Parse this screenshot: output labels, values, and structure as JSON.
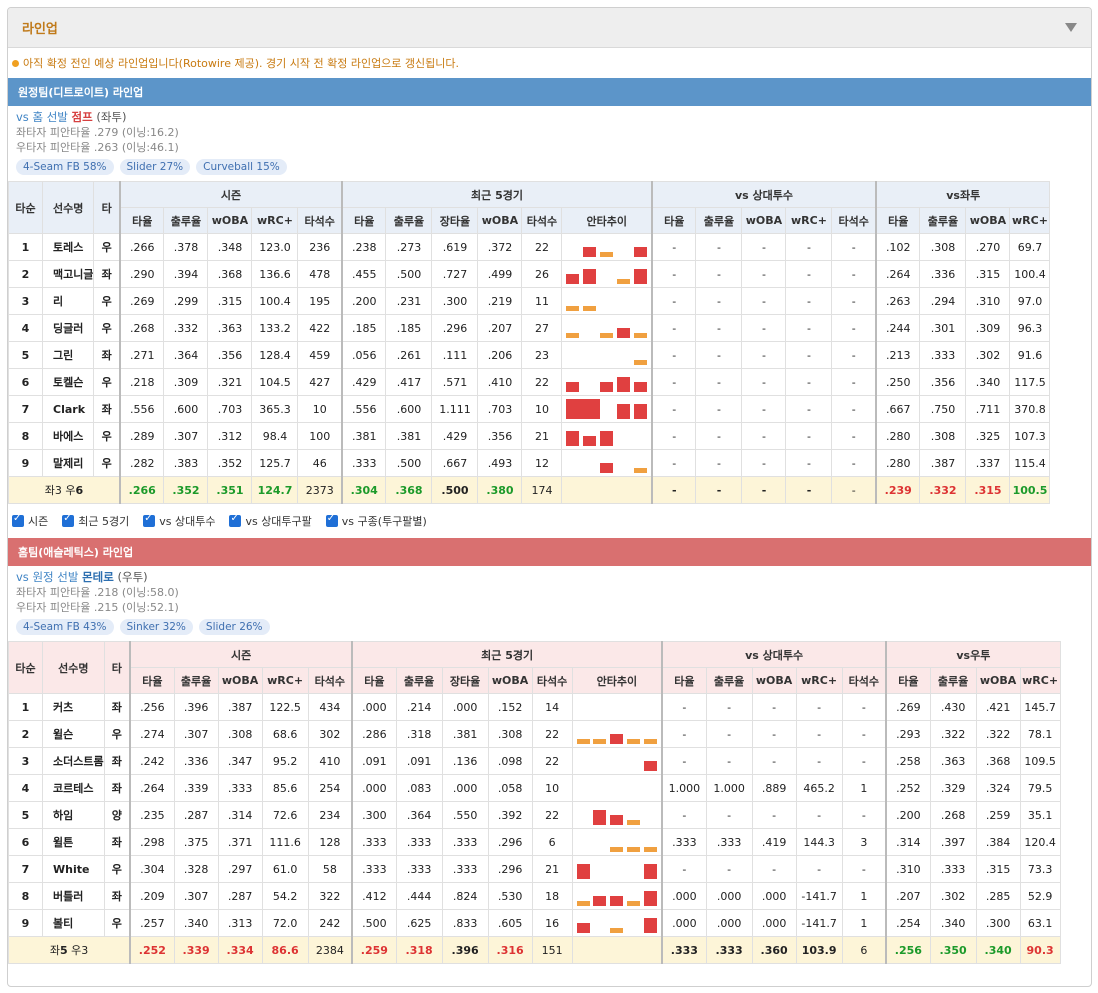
{
  "panel": {
    "title": "라인업",
    "notice": "아직 확정 전인 예상 라인업입니다(Rotowire 제공). 경기 시작 전 확정 라인업으로 갱신됩니다."
  },
  "away": {
    "bar": "원정팀(디트로이트) 라인업",
    "vs_text": "vs 홈 선발",
    "pitcher_name": "점프",
    "pitcher_hand": "(좌투)",
    "stat_lhb": "좌타자 피안타율 .279 (이닝:16.2)",
    "stat_rhb": "우타자 피안타율 .263 (이닝:46.1)",
    "pitches": [
      "4-Seam FB 58%",
      "Slider 27%",
      "Curveball 15%"
    ],
    "split_header": "vs좌투",
    "rows": [
      {
        "o": "1",
        "n": "토레스",
        "h": "우",
        "s": [
          ".266",
          ".378",
          ".348",
          "123.0",
          "236"
        ],
        "r": [
          ".238",
          ".273",
          ".619",
          ".372",
          "22"
        ],
        "spark": [
          0,
          2,
          1,
          0,
          2
        ],
        "v": [
          "-",
          "-",
          "-",
          "-",
          "-"
        ],
        "sp": [
          ".102",
          ".308",
          ".270",
          "69.7"
        ]
      },
      {
        "o": "2",
        "n": "맥고니글",
        "h": "좌",
        "s": [
          ".290",
          ".394",
          ".368",
          "136.6",
          "478"
        ],
        "r": [
          ".455",
          ".500",
          ".727",
          ".499",
          "26"
        ],
        "spark": [
          2,
          3,
          0,
          1,
          3
        ],
        "v": [
          "-",
          "-",
          "-",
          "-",
          "-"
        ],
        "sp": [
          ".264",
          ".336",
          ".315",
          "100.4"
        ]
      },
      {
        "o": "3",
        "n": "리",
        "h": "우",
        "s": [
          ".269",
          ".299",
          ".315",
          "100.4",
          "195"
        ],
        "r": [
          ".200",
          ".231",
          ".300",
          ".219",
          "11"
        ],
        "spark": [
          1,
          1,
          0,
          0,
          0
        ],
        "v": [
          "-",
          "-",
          "-",
          "-",
          "-"
        ],
        "sp": [
          ".263",
          ".294",
          ".310",
          "97.0"
        ]
      },
      {
        "o": "4",
        "n": "딩글러",
        "h": "우",
        "s": [
          ".268",
          ".332",
          ".363",
          "133.2",
          "422"
        ],
        "r": [
          ".185",
          ".185",
          ".296",
          ".207",
          "27"
        ],
        "spark": [
          1,
          0,
          1,
          2,
          1
        ],
        "v": [
          "-",
          "-",
          "-",
          "-",
          "-"
        ],
        "sp": [
          ".244",
          ".301",
          ".309",
          "96.3"
        ]
      },
      {
        "o": "5",
        "n": "그린",
        "h": "좌",
        "s": [
          ".271",
          ".364",
          ".356",
          "128.4",
          "459"
        ],
        "r": [
          ".056",
          ".261",
          ".111",
          ".206",
          "23"
        ],
        "spark": [
          0,
          0,
          0,
          0,
          1
        ],
        "v": [
          "-",
          "-",
          "-",
          "-",
          "-"
        ],
        "sp": [
          ".213",
          ".333",
          ".302",
          "91.6"
        ]
      },
      {
        "o": "6",
        "n": "토켈슨",
        "h": "우",
        "s": [
          ".218",
          ".309",
          ".321",
          "104.5",
          "427"
        ],
        "r": [
          ".429",
          ".417",
          ".571",
          ".410",
          "22"
        ],
        "spark": [
          2,
          0,
          2,
          3,
          2
        ],
        "v": [
          "-",
          "-",
          "-",
          "-",
          "-"
        ],
        "sp": [
          ".250",
          ".356",
          ".340",
          "117.5"
        ]
      },
      {
        "o": "7",
        "n": "Clark",
        "h": "좌",
        "s": [
          ".556",
          ".600",
          ".703",
          "365.3",
          "10"
        ],
        "r": [
          ".556",
          ".600",
          "1.111",
          ".703",
          "10"
        ],
        "spark": [
          4,
          4,
          0,
          3,
          3
        ],
        "v": [
          "-",
          "-",
          "-",
          "-",
          "-"
        ],
        "sp": [
          ".667",
          ".750",
          ".711",
          "370.8"
        ]
      },
      {
        "o": "8",
        "n": "바에스",
        "h": "우",
        "s": [
          ".289",
          ".307",
          ".312",
          "98.4",
          "100"
        ],
        "r": [
          ".381",
          ".381",
          ".429",
          ".356",
          "21"
        ],
        "spark": [
          3,
          2,
          3,
          0,
          0
        ],
        "v": [
          "-",
          "-",
          "-",
          "-",
          "-"
        ],
        "sp": [
          ".280",
          ".308",
          ".325",
          "107.3"
        ]
      },
      {
        "o": "9",
        "n": "말제리",
        "h": "우",
        "s": [
          ".282",
          ".383",
          ".352",
          "125.7",
          "46"
        ],
        "r": [
          ".333",
          ".500",
          ".667",
          ".493",
          "12"
        ],
        "spark": [
          0,
          0,
          2,
          0,
          1
        ],
        "v": [
          "-",
          "-",
          "-",
          "-",
          "-"
        ],
        "sp": [
          ".280",
          ".387",
          ".337",
          "115.4"
        ]
      }
    ],
    "total": {
      "label_pre": "좌3 우",
      "label_bold": "6",
      "s": [
        ".266",
        ".352",
        ".351",
        "124.7",
        "2373"
      ],
      "r": [
        ".304",
        ".368",
        ".500",
        ".380",
        "174"
      ],
      "v": [
        "-",
        "-",
        "-",
        "-",
        "-"
      ],
      "sp": [
        ".239",
        ".332",
        ".315",
        "100.5"
      ]
    }
  },
  "checks": [
    "시즌",
    "최근 5경기",
    "vs 상대투수",
    "vs 상대투구팔",
    "vs 구종(투구팔별)"
  ],
  "home": {
    "bar": "홈팀(애슬레틱스) 라인업",
    "vs_text": "vs 원정 선발",
    "pitcher_name": "몬테로",
    "pitcher_hand": "(우투)",
    "stat_lhb": "좌타자 피안타율 .218 (이닝:58.0)",
    "stat_rhb": "우타자 피안타율 .215 (이닝:52.1)",
    "pitches": [
      "4-Seam FB 43%",
      "Sinker 32%",
      "Slider 26%"
    ],
    "split_header": "vs우투",
    "rows": [
      {
        "o": "1",
        "n": "커츠",
        "h": "좌",
        "s": [
          ".256",
          ".396",
          ".387",
          "122.5",
          "434"
        ],
        "r": [
          ".000",
          ".214",
          ".000",
          ".152",
          "14"
        ],
        "spark": [
          0,
          0,
          0,
          0,
          0
        ],
        "v": [
          "-",
          "-",
          "-",
          "-",
          "-"
        ],
        "sp": [
          ".269",
          ".430",
          ".421",
          "145.7"
        ]
      },
      {
        "o": "2",
        "n": "윌슨",
        "h": "우",
        "s": [
          ".274",
          ".307",
          ".308",
          "68.6",
          "302"
        ],
        "r": [
          ".286",
          ".318",
          ".381",
          ".308",
          "22"
        ],
        "spark": [
          1,
          1,
          2,
          1,
          1
        ],
        "v": [
          "-",
          "-",
          "-",
          "-",
          "-"
        ],
        "sp": [
          ".293",
          ".322",
          ".322",
          "78.1"
        ]
      },
      {
        "o": "3",
        "n": "소더스트롬",
        "h": "좌",
        "s": [
          ".242",
          ".336",
          ".347",
          "95.2",
          "410"
        ],
        "r": [
          ".091",
          ".091",
          ".136",
          ".098",
          "22"
        ],
        "spark": [
          0,
          0,
          0,
          0,
          2
        ],
        "v": [
          "-",
          "-",
          "-",
          "-",
          "-"
        ],
        "sp": [
          ".258",
          ".363",
          ".368",
          "109.5"
        ]
      },
      {
        "o": "4",
        "n": "코르테스",
        "h": "좌",
        "s": [
          ".264",
          ".339",
          ".333",
          "85.6",
          "254"
        ],
        "r": [
          ".000",
          ".083",
          ".000",
          ".058",
          "10"
        ],
        "spark": [
          0,
          0,
          0,
          0,
          0
        ],
        "v": [
          "1.000",
          "1.000",
          ".889",
          "465.2",
          "1"
        ],
        "sp": [
          ".252",
          ".329",
          ".324",
          "79.5"
        ]
      },
      {
        "o": "5",
        "n": "하임",
        "h": "양",
        "s": [
          ".235",
          ".287",
          ".314",
          "72.6",
          "234"
        ],
        "r": [
          ".300",
          ".364",
          ".550",
          ".392",
          "22"
        ],
        "spark": [
          0,
          3,
          2,
          1,
          0
        ],
        "v": [
          "-",
          "-",
          "-",
          "-",
          "-"
        ],
        "sp": [
          ".200",
          ".268",
          ".259",
          "35.1"
        ]
      },
      {
        "o": "6",
        "n": "윌튼",
        "h": "좌",
        "s": [
          ".298",
          ".375",
          ".371",
          "111.6",
          "128"
        ],
        "r": [
          ".333",
          ".333",
          ".333",
          ".296",
          "6"
        ],
        "spark": [
          0,
          0,
          1,
          1,
          1
        ],
        "v": [
          ".333",
          ".333",
          ".419",
          "144.3",
          "3"
        ],
        "sp": [
          ".314",
          ".397",
          ".384",
          "120.4"
        ]
      },
      {
        "o": "7",
        "n": "White",
        "h": "우",
        "s": [
          ".304",
          ".328",
          ".297",
          "61.0",
          "58"
        ],
        "r": [
          ".333",
          ".333",
          ".333",
          ".296",
          "21"
        ],
        "spark": [
          3,
          0,
          0,
          0,
          3
        ],
        "v": [
          "-",
          "-",
          "-",
          "-",
          "-"
        ],
        "sp": [
          ".310",
          ".333",
          ".315",
          "73.3"
        ]
      },
      {
        "o": "8",
        "n": "버틀러",
        "h": "좌",
        "s": [
          ".209",
          ".307",
          ".287",
          "54.2",
          "322"
        ],
        "r": [
          ".412",
          ".444",
          ".824",
          ".530",
          "18"
        ],
        "spark": [
          1,
          2,
          2,
          1,
          3
        ],
        "v": [
          ".000",
          ".000",
          ".000",
          "-141.7",
          "1"
        ],
        "sp": [
          ".207",
          ".302",
          ".285",
          "52.9"
        ]
      },
      {
        "o": "9",
        "n": "볼티",
        "h": "우",
        "s": [
          ".257",
          ".340",
          ".313",
          "72.0",
          "242"
        ],
        "r": [
          ".500",
          ".625",
          ".833",
          ".605",
          "16"
        ],
        "spark": [
          2,
          0,
          1,
          0,
          3
        ],
        "v": [
          ".000",
          ".000",
          ".000",
          "-141.7",
          "1"
        ],
        "sp": [
          ".254",
          ".340",
          ".300",
          "63.1"
        ]
      }
    ],
    "total": {
      "label_pre": "좌",
      "label_bold": "5",
      "label_post": " 우3",
      "s": [
        ".252",
        ".339",
        ".334",
        "86.6",
        "2384"
      ],
      "r": [
        ".259",
        ".318",
        ".396",
        ".316",
        "151"
      ],
      "v": [
        ".333",
        ".333",
        ".360",
        "103.9",
        "6"
      ],
      "sp": [
        ".256",
        ".350",
        ".340",
        "90.3"
      ]
    }
  },
  "headers": {
    "order": "타순",
    "name": "선수명",
    "hand": "타",
    "season": "시즌",
    "recent": "최근 5경기",
    "vs_pitcher": "vs 상대투수",
    "cols_season": [
      "타율",
      "출루율",
      "wOBA",
      "wRC+",
      "타석수"
    ],
    "cols_recent": [
      "타율",
      "출루율",
      "장타율",
      "wOBA",
      "타석수",
      "안타추이"
    ],
    "cols_vs": [
      "타율",
      "출루율",
      "wOBA",
      "wRC+",
      "타석수"
    ],
    "cols_split": [
      "타율",
      "출루율",
      "wOBA",
      "wRC+"
    ]
  },
  "colors": {
    "away_bar": "#5c95c9",
    "home_bar": "#d97070",
    "spark_high": "#e04040",
    "spark_low": "#f0a040",
    "total_bg": "#fdf5d8"
  }
}
